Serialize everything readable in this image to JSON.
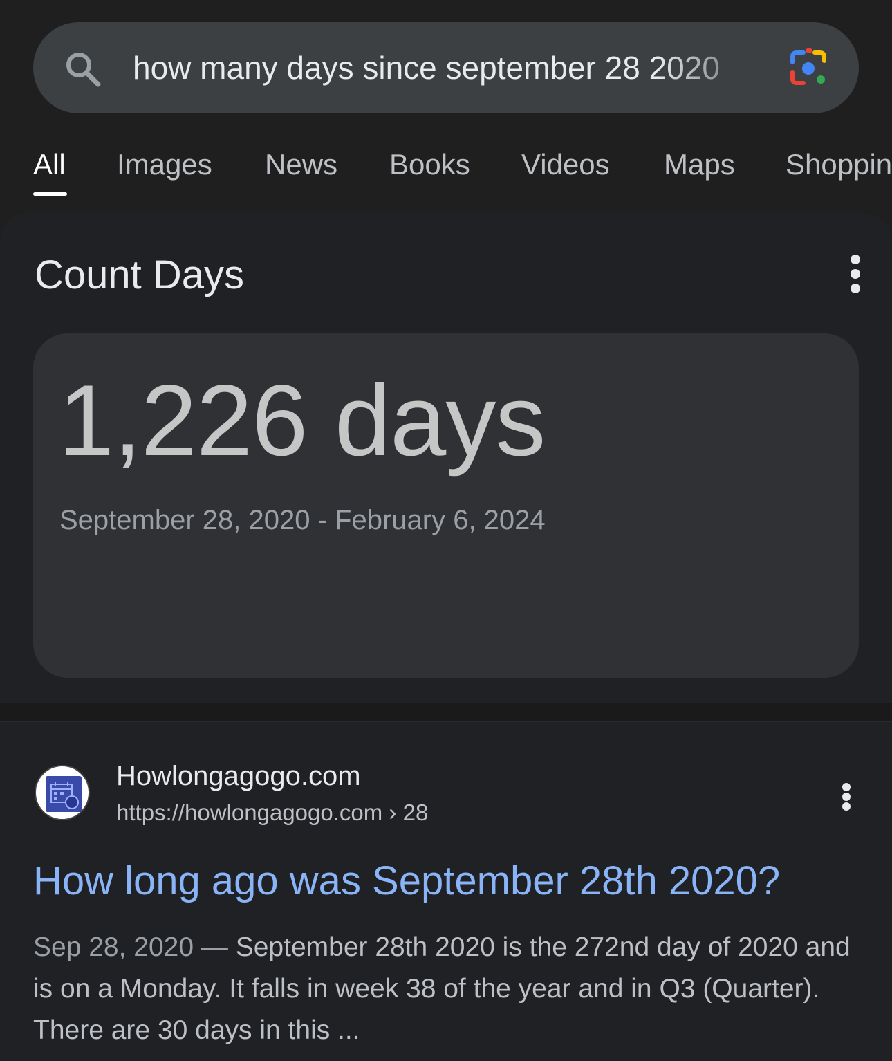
{
  "search": {
    "query": "how many days since september 28 2020"
  },
  "tabs": [
    {
      "label": "All",
      "active": true
    },
    {
      "label": "Images"
    },
    {
      "label": "News"
    },
    {
      "label": "Books"
    },
    {
      "label": "Videos"
    },
    {
      "label": "Maps"
    },
    {
      "label": "Shoppin"
    }
  ],
  "answer": {
    "title": "Count Days",
    "value": "1,226 days",
    "range": "September 28, 2020 - February 6, 2024"
  },
  "result": {
    "site_name": "Howlongagogo.com",
    "url": "https://howlongagogo.com",
    "url_path": " › 28",
    "title": "How long ago was September 28th 2020?",
    "snippet_date": "Sep 28, 2020",
    "snippet_separator": " — ",
    "snippet_text": "September 28th 2020 is the 272nd day of 2020 and is on a Monday. It falls in week 38 of the year and in Q3 (Quarter). There are 30 days in this ..."
  },
  "colors": {
    "background": "#1f1f1f",
    "card": "#303134",
    "link": "#8ab4f8"
  }
}
